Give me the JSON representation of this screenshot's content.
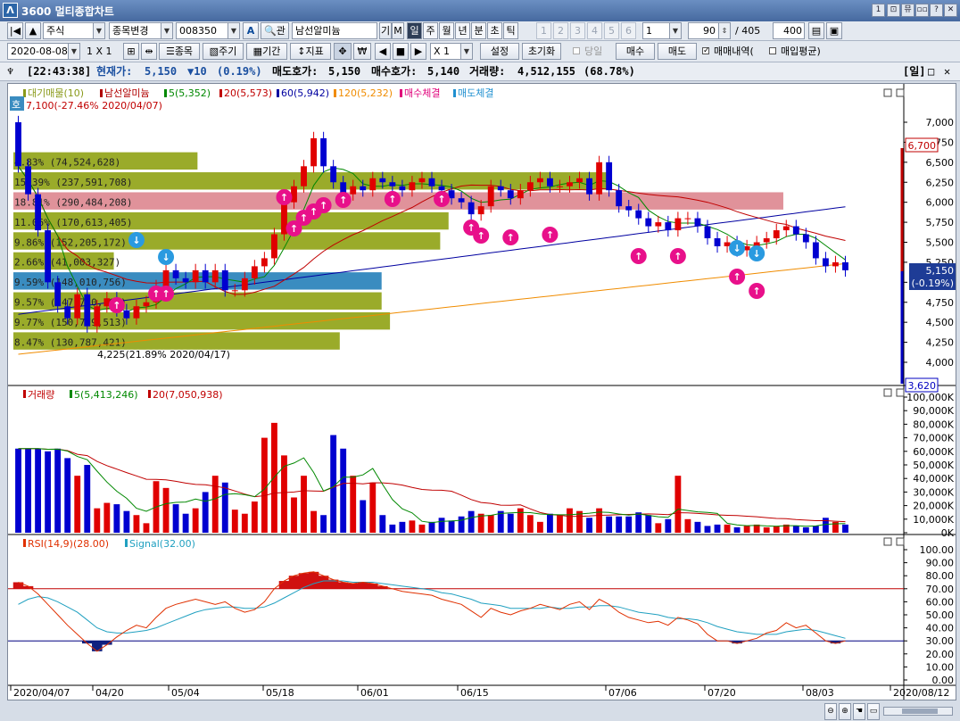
{
  "window": {
    "title": "3600 멀티종합차트",
    "logo": "Λ",
    "buttons": [
      "1",
      "⊡",
      "뮤",
      "▫▫",
      "?",
      "✕"
    ]
  },
  "toolbar1": {
    "market_value": "주식",
    "change_label": "종목변경",
    "code_value": "008350",
    "search_icon_label": "관",
    "name_value": "남선알미늄",
    "gi_label": "기",
    "m_label": "M",
    "periods": [
      "일",
      "주",
      "월",
      "년",
      "분",
      "초",
      "틱"
    ],
    "numbers": [
      "1",
      "2",
      "3",
      "4",
      "5",
      "6"
    ],
    "unit_value": "1",
    "count_value": "90",
    "count_total": "/ 405",
    "max_value": "400"
  },
  "toolbar2": {
    "date_value": "2020-08-08",
    "layout_label": "1 X 1",
    "btn_item": "종목",
    "btn_cycle": "주기",
    "btn_period": "기간",
    "btn_indicator": "지표",
    "btn_won": "₩",
    "zoom_value": "X 1",
    "btn_settings": "설정",
    "btn_reset": "초기화",
    "chk_today": "당일",
    "btn_buy": "매수",
    "btn_sell": "매도",
    "chk_trades": "매매내역(",
    "chk_avg": "매입평균)"
  },
  "infobar": {
    "time": "[22:43:38]",
    "cur_label": "현재가:",
    "cur_value": "5,150",
    "chg_value": "▼10",
    "chg_pct": "(0.19%)",
    "ask_label": "매도호가:",
    "ask_value": "5,150",
    "bid_label": "매수호가:",
    "bid_value": "5,140",
    "vol_label": "거래량:",
    "vol_value": "4,512,155",
    "vol_pct": "(68.78%)",
    "period_badge": "[일]"
  },
  "price_panel": {
    "legend": [
      "대기매물(10)",
      "남선알미늄",
      "5(5,352)",
      "20(5,573)",
      "60(5,942)",
      "120(5,232)",
      "매수체결",
      "매도체결"
    ],
    "legend_colors": [
      "#8a9a1a",
      "#b00000",
      "#008800",
      "#c00000",
      "#0000a0",
      "#f08c00",
      "#e0007a",
      "#2090d0"
    ],
    "corner_tag": "호",
    "max_label": "7,100(-27.46% 2020/04/07)",
    "min_label": "4,225(21.89% 2020/04/17)",
    "y_ticks": [
      "7,000",
      "6,750",
      "6,500",
      "6,250",
      "6,000",
      "5,750",
      "5,500",
      "5,250",
      "5,000",
      "4,750",
      "4,500",
      "4,250",
      "4,000"
    ],
    "right_high": "6,700",
    "right_cur": "5,150",
    "right_cur_pct": "(-0.19%)",
    "right_low": "3,620",
    "profile": [
      {
        "label": "4.83% (74,524,628)",
        "price": 6500,
        "len": 0.22,
        "color": "#9aab2a"
      },
      {
        "label": "15.39% (237,591,708)",
        "price": 6250,
        "len": 0.71,
        "color": "#9aab2a"
      },
      {
        "label": "18.81% (290,484,208)",
        "price": 6000,
        "len": 0.92,
        "color": "#e0929a"
      },
      {
        "label": "11.06% (170,613,405)",
        "price": 5750,
        "len": 0.52,
        "color": "#9aab2a"
      },
      {
        "label": "9.86% (152,205,172)",
        "price": 5500,
        "len": 0.51,
        "color": "#9aab2a"
      },
      {
        "label": "2.66% (41,003,327)",
        "price": 5250,
        "len": 0.12,
        "color": "#9aab2a"
      },
      {
        "label": "9.59% (148,010,756)",
        "price": 5000,
        "len": 0.44,
        "color": "#3a8cc0"
      },
      {
        "label": "9.57% (147,730,166)",
        "price": 4750,
        "len": 0.44,
        "color": "#9aab2a"
      },
      {
        "label": "9.77% (150,779,513)",
        "price": 4500,
        "len": 0.45,
        "color": "#9aab2a"
      },
      {
        "label": "8.47% (130,787,421)",
        "price": 4250,
        "len": 0.39,
        "color": "#9aab2a"
      }
    ]
  },
  "volume_panel": {
    "legend": [
      "거래량",
      "5(5,413,246)",
      "20(7,050,938)"
    ],
    "legend_colors": [
      "#c00000",
      "#008800",
      "#c00000"
    ],
    "y_ticks": [
      "100,000K",
      "90,000K",
      "80,000K",
      "70,000K",
      "60,000K",
      "50,000K",
      "40,000K",
      "30,000K",
      "20,000K",
      "10,000K",
      "0K"
    ]
  },
  "rsi_panel": {
    "legend": [
      "RSI(14,9)(28.00)",
      "Signal(32.00)"
    ],
    "legend_colors": [
      "#e03000",
      "#20a0c0"
    ],
    "y_ticks": [
      "100.00",
      "90.00",
      "80.00",
      "70.00",
      "60.00",
      "50.00",
      "40.00",
      "30.00",
      "20.00",
      "10.00",
      "0.00"
    ]
  },
  "x_labels": [
    "2020/04/07",
    "04/20",
    "05/04",
    "05/18",
    "06/01",
    "06/15",
    "07/06",
    "07/20",
    "08/03",
    "2020/08/12"
  ],
  "chart_data": {
    "type": "candlestick",
    "dates": [
      "04/07",
      "04/08",
      "04/09",
      "04/10",
      "04/13",
      "04/14",
      "04/16",
      "04/17",
      "04/20",
      "04/21",
      "04/22",
      "04/23",
      "04/24",
      "04/27",
      "04/28",
      "04/29",
      "05/04",
      "05/06",
      "05/07",
      "05/08",
      "05/11",
      "05/12",
      "05/13",
      "05/14",
      "05/15",
      "05/18",
      "05/19",
      "05/20",
      "05/21",
      "05/22",
      "05/25",
      "05/26",
      "05/27",
      "05/28",
      "05/29",
      "06/01",
      "06/02",
      "06/03",
      "06/04",
      "06/05",
      "06/08",
      "06/09",
      "06/10",
      "06/11",
      "06/12",
      "06/15",
      "06/16",
      "06/17",
      "06/18",
      "06/19",
      "06/22",
      "06/23",
      "06/24",
      "06/25",
      "06/26",
      "06/29",
      "06/30",
      "07/01",
      "07/02",
      "07/03",
      "07/06",
      "07/07",
      "07/08",
      "07/09",
      "07/10",
      "07/13",
      "07/14",
      "07/15",
      "07/16",
      "07/17",
      "07/20",
      "07/21",
      "07/22",
      "07/23",
      "07/24",
      "07/27",
      "07/28",
      "07/29",
      "07/30",
      "07/31",
      "08/03",
      "08/04",
      "08/05",
      "08/06",
      "08/07"
    ],
    "open": [
      7000,
      6450,
      6100,
      5650,
      5000,
      4700,
      4550,
      4850,
      4450,
      4700,
      4800,
      4650,
      4550,
      4700,
      4750,
      4950,
      5150,
      5050,
      5000,
      5150,
      5000,
      5150,
      4900,
      4900,
      5050,
      5200,
      5300,
      5600,
      6000,
      6200,
      6450,
      6800,
      6450,
      6250,
      6100,
      6200,
      6150,
      6300,
      6250,
      6200,
      6150,
      6250,
      6300,
      6200,
      6150,
      6050,
      6000,
      5850,
      5950,
      6200,
      6150,
      6050,
      6150,
      6250,
      6300,
      6200,
      6200,
      6250,
      6300,
      6100,
      6500,
      6150,
      5950,
      5900,
      5800,
      5700,
      5750,
      5650,
      5800,
      5800,
      5700,
      5550,
      5450,
      5500,
      5400,
      5450,
      5500,
      5550,
      5650,
      5700,
      5600,
      5500,
      5300,
      5200,
      5250
    ],
    "close": [
      6450,
      6100,
      5650,
      5000,
      4700,
      4550,
      4850,
      4450,
      4700,
      4800,
      4650,
      4550,
      4700,
      4750,
      4950,
      5150,
      5050,
      5000,
      5150,
      5000,
      5150,
      4900,
      4900,
      5050,
      5200,
      5300,
      5600,
      6000,
      6200,
      6450,
      6800,
      6450,
      6250,
      6100,
      6200,
      6150,
      6300,
      6250,
      6200,
      6150,
      6250,
      6300,
      6200,
      6150,
      6050,
      6000,
      5850,
      5950,
      6200,
      6150,
      6050,
      6150,
      6250,
      6300,
      6200,
      6200,
      6250,
      6300,
      6100,
      6500,
      6150,
      5950,
      5900,
      5800,
      5700,
      5750,
      5650,
      5800,
      5800,
      5700,
      5550,
      5450,
      5500,
      5400,
      5450,
      5500,
      5550,
      5650,
      5700,
      5600,
      5500,
      5300,
      5200,
      5250,
      5150
    ],
    "volume_k": [
      62000,
      62000,
      62000,
      60000,
      62000,
      55000,
      42000,
      50000,
      18000,
      22000,
      21000,
      16000,
      13000,
      7000,
      38000,
      33000,
      21000,
      14000,
      18000,
      30000,
      42000,
      37000,
      17000,
      14000,
      23000,
      70000,
      81000,
      57000,
      26000,
      42000,
      16000,
      13000,
      72000,
      62000,
      42000,
      24000,
      37000,
      13000,
      6000,
      8000,
      9000,
      6000,
      8000,
      11000,
      9000,
      12000,
      16000,
      14000,
      13000,
      16000,
      14000,
      18000,
      13000,
      8000,
      14000,
      13000,
      18000,
      16000,
      11000,
      18000,
      12000,
      12000,
      12000,
      15000,
      13000,
      7000,
      10000,
      42000,
      10000,
      8000,
      5000,
      6000,
      6000,
      4000,
      5000,
      6000,
      4000,
      5000,
      6000,
      5000,
      4000,
      5000,
      11000,
      8000,
      6000
    ],
    "rsi": [
      75,
      72,
      66,
      58,
      50,
      42,
      35,
      28,
      22,
      27,
      33,
      38,
      42,
      40,
      48,
      55,
      58,
      60,
      62,
      60,
      58,
      60,
      55,
      52,
      54,
      60,
      70,
      76,
      80,
      82,
      83,
      80,
      77,
      75,
      74,
      75,
      74,
      72,
      70,
      68,
      67,
      66,
      65,
      62,
      60,
      58,
      53,
      48,
      55,
      52,
      50,
      53,
      55,
      58,
      56,
      54,
      58,
      60,
      54,
      62,
      58,
      52,
      48,
      46,
      44,
      45,
      42,
      48,
      46,
      43,
      35,
      30,
      30,
      28,
      30,
      32,
      36,
      38,
      44,
      40,
      42,
      36,
      30,
      28,
      30
    ],
    "signal": [
      58,
      62,
      64,
      63,
      60,
      56,
      52,
      46,
      40,
      37,
      36,
      36,
      37,
      38,
      40,
      43,
      46,
      49,
      52,
      54,
      55,
      56,
      56,
      55,
      55,
      56,
      59,
      63,
      67,
      71,
      74,
      76,
      76,
      76,
      75,
      75,
      75,
      74,
      73,
      72,
      71,
      70,
      69,
      67,
      66,
      64,
      62,
      59,
      58,
      57,
      55,
      55,
      55,
      55,
      56,
      55,
      55,
      56,
      56,
      57,
      57,
      56,
      54,
      52,
      51,
      50,
      48,
      47,
      47,
      46,
      44,
      41,
      39,
      37,
      36,
      35,
      35,
      35,
      37,
      38,
      39,
      38,
      36,
      34,
      32
    ]
  }
}
